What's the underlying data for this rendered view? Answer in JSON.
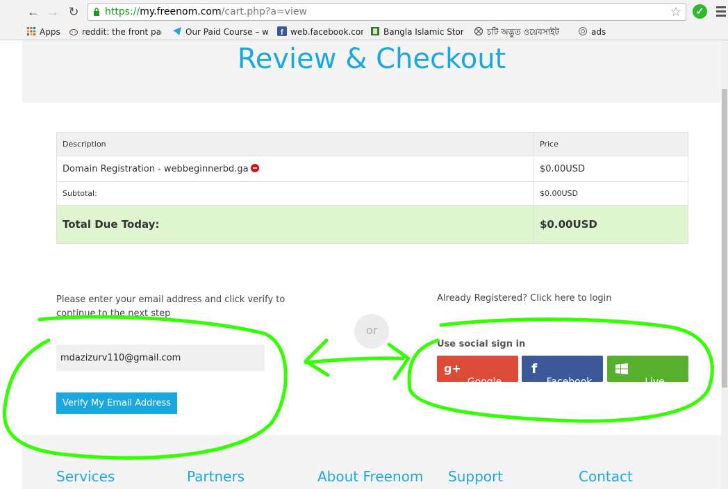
{
  "browser": {
    "url_scheme": "https://",
    "url_host": "my.freenom.com",
    "url_path": "/cart.php?a=view",
    "bookmarks": [
      {
        "label": "Apps",
        "icon": "apps-grid-icon"
      },
      {
        "label": "reddit: the front page",
        "icon": "reddit-icon"
      },
      {
        "label": "Our Paid Course – ww",
        "icon": "telegram-icon"
      },
      {
        "label": "web.facebook.com",
        "icon": "facebook-icon"
      },
      {
        "label": "Bangla Islamic Story |",
        "icon": "book-icon"
      },
      {
        "label": "চটি অদ্ভুত ওয়েবসাইট",
        "icon": "globe-icon"
      },
      {
        "label": "ads",
        "icon": "target-icon"
      }
    ]
  },
  "page": {
    "title": "Review & Checkout",
    "cart": {
      "headers": {
        "description": "Description",
        "price": "Price"
      },
      "item": {
        "description": "Domain Registration - webbeginnerbd.ga",
        "price": "$0.00USD"
      },
      "subtotal": {
        "label": "Subtotal:",
        "value": "$0.00USD"
      },
      "total": {
        "label": "Total Due Today:",
        "value": "$0.00USD"
      }
    },
    "email_section": {
      "message": "Please enter your email address and click verify to continue to the next step",
      "email_value": "mdazizurv110@gmail.com",
      "verify_label": "Verify My Email Address"
    },
    "or_label": "or",
    "login_section": {
      "already_registered": "Already Registered? Click here to login",
      "social_title": "Use social sign in",
      "buttons": {
        "google": "Google",
        "facebook": "Facebook",
        "live": "Live"
      },
      "colors": {
        "google": "#dc4a38",
        "facebook": "#3b5998",
        "live": "#56b02e"
      }
    },
    "footer": [
      "Services",
      "Partners",
      "About Freenom",
      "Support",
      "Contact"
    ]
  },
  "colors": {
    "accent": "#1ba8e0",
    "total_bg": "#dff5cf",
    "annotation": "#33ff00"
  }
}
